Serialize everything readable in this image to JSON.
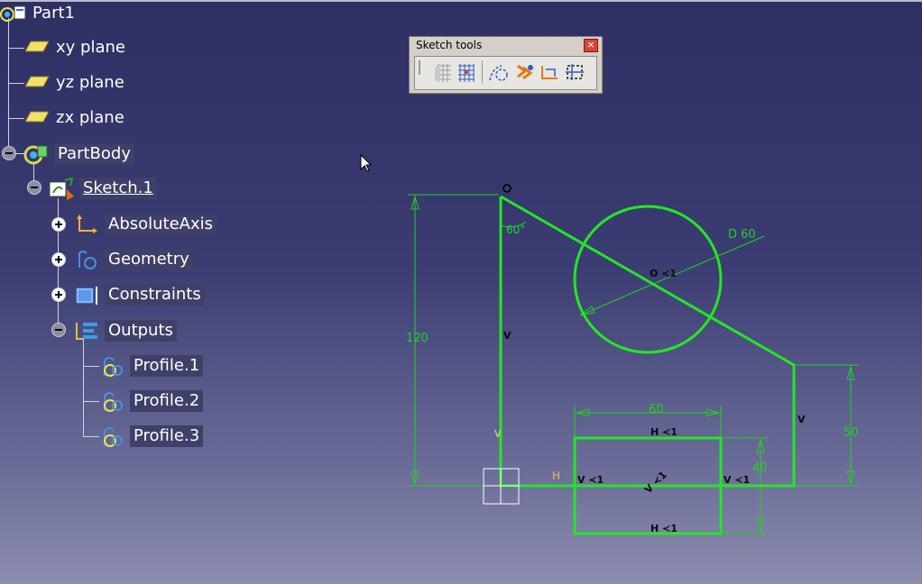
{
  "tree": {
    "root": "Part1",
    "planes": [
      "xy plane",
      "yz plane",
      "zx plane"
    ],
    "body": "PartBody",
    "sketch": "Sketch.1",
    "children": [
      "AbsoluteAxis",
      "Geometry",
      "Constraints",
      "Outputs"
    ],
    "profiles": [
      "Profile.1",
      "Profile.2",
      "Profile.3"
    ]
  },
  "toolbar": {
    "title": "Sketch tools",
    "close": "×",
    "buttons": [
      "grid-icon",
      "snap-to-point-icon",
      "construction-element-icon",
      "geometrical-constraints-icon",
      "dimensional-constraints-icon",
      "analysis-icon"
    ]
  },
  "sketch": {
    "dimensions": {
      "angle": "60°",
      "diameter": "D 60",
      "height_left": "120",
      "height_right": "50",
      "rect_width": "60",
      "rect_height": "40"
    },
    "constraint_marks": {
      "v": "V",
      "h": "H",
      "v_sym": "V ≺1",
      "h_sym": "H ≺1",
      "o": "O ≺1"
    }
  },
  "colors": {
    "geometry": "#22e822",
    "dimension": "#25d025",
    "background_top": "#2e2f63"
  }
}
